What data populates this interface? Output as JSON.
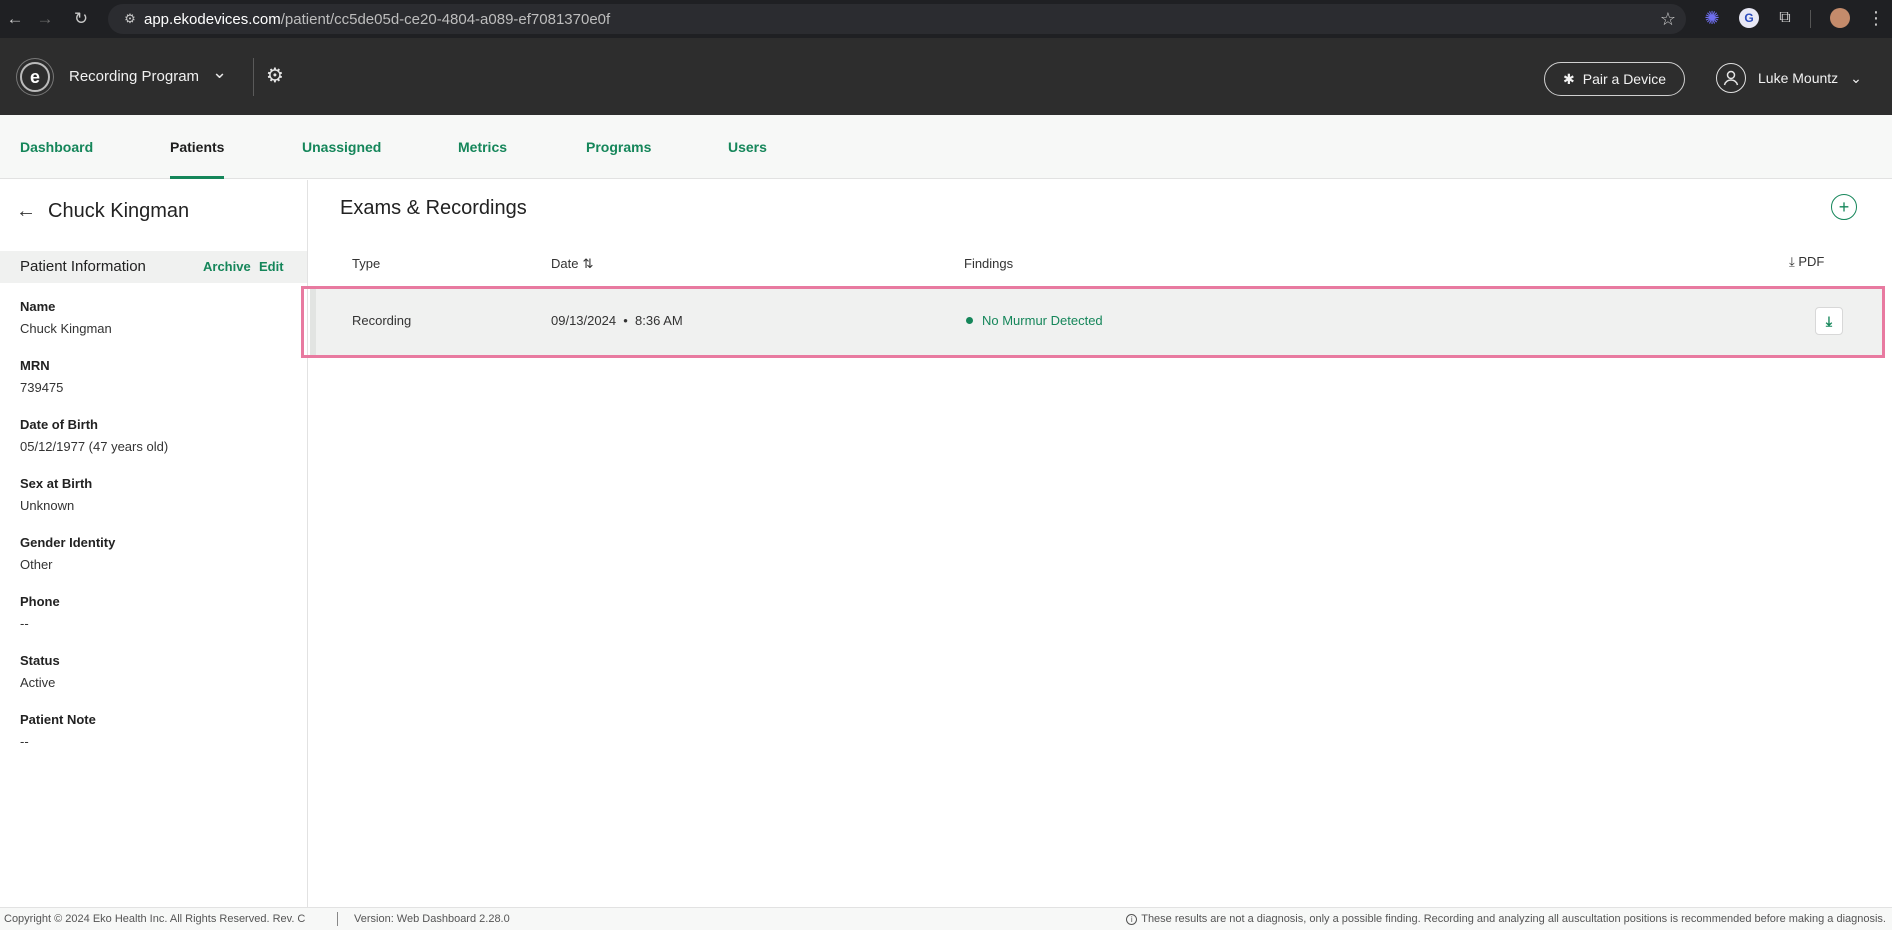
{
  "browser": {
    "url_host": "app.ekodevices.com",
    "url_path": "/patient/cc5de05d-ce20-4804-a089-ef7081370e0f",
    "back_icon": "←",
    "forward_icon": "→",
    "reload_icon": "↻",
    "tune_icon": "⚙",
    "star_icon": "☆",
    "ext_icons": [
      "✺",
      "G",
      "⧉",
      "⋮"
    ]
  },
  "header": {
    "logo_letter": "e",
    "program_name": "Recording Program",
    "chevron": "⌄",
    "settings_icon": "⚙",
    "pair_button_icon": "✱",
    "pair_button": "Pair a Device",
    "user_icon": "👤",
    "user_name": "Luke Mountz",
    "user_chevron": "⌄"
  },
  "tabs": [
    {
      "label": "Dashboard"
    },
    {
      "label": "Patients"
    },
    {
      "label": "Unassigned"
    },
    {
      "label": "Metrics"
    },
    {
      "label": "Programs"
    },
    {
      "label": "Users"
    }
  ],
  "patient": {
    "back_icon": "←",
    "name": "Chuck Kingman",
    "info_title": "Patient Information",
    "archive_label": "Archive",
    "edit_label": "Edit",
    "fields": [
      {
        "label": "Name",
        "value": "Chuck Kingman"
      },
      {
        "label": "MRN",
        "value": "739475"
      },
      {
        "label": "Date of Birth",
        "value": "05/12/1977 (47 years old)"
      },
      {
        "label": "Sex at Birth",
        "value": "Unknown"
      },
      {
        "label": "Gender Identity",
        "value": "Other"
      },
      {
        "label": "Phone",
        "value": "--"
      },
      {
        "label": "Status",
        "value": "Active"
      },
      {
        "label": "Patient Note",
        "value": "--"
      }
    ]
  },
  "exams": {
    "title": "Exams & Recordings",
    "add_icon": "+",
    "columns": {
      "type": "Type",
      "date": "Date",
      "sort_icon": "⇅",
      "findings": "Findings",
      "pdf_icon": "⤓",
      "pdf": "PDF"
    },
    "rows": [
      {
        "type": "Recording",
        "date": "09/13/2024  •  8:36 AM",
        "finding": "No Murmur Detected",
        "download_icon": "⤓"
      }
    ]
  },
  "footer": {
    "copyright": "Copyright © 2024 Eko Health Inc. All Rights Reserved. Rev. C",
    "version": "Version: Web Dashboard 2.28.0",
    "info_icon": "i",
    "disclaimer": "These results are not a diagnosis, only a possible finding. Recording and analyzing all auscultation positions is recommended before making a diagnosis."
  },
  "colors": {
    "accent": "#15865a",
    "header_bg": "#2d2d2d",
    "highlight_border": "#e87aa0"
  }
}
